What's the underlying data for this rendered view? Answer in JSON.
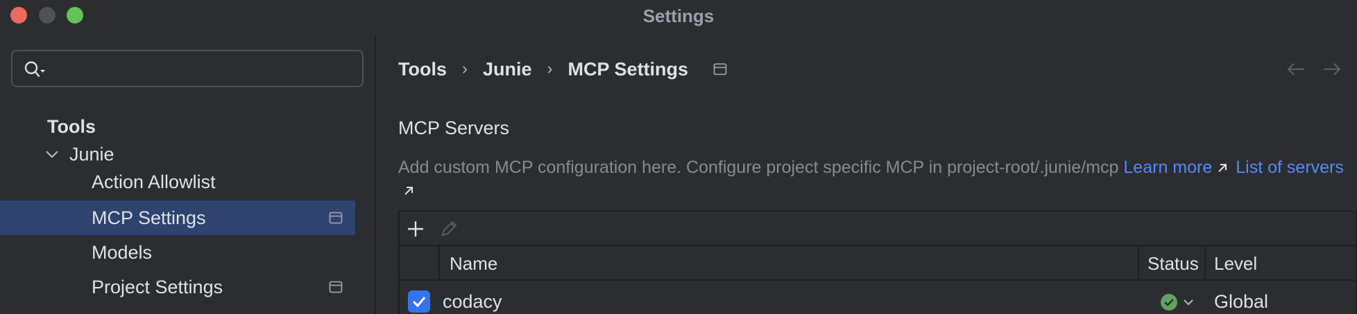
{
  "window": {
    "title": "Settings"
  },
  "search": {
    "placeholder": "",
    "value": ""
  },
  "sidebar": {
    "items": [
      {
        "label": "Tools"
      },
      {
        "label": "Junie"
      },
      {
        "label": "Action Allowlist"
      },
      {
        "label": "MCP Settings"
      },
      {
        "label": "Models"
      },
      {
        "label": "Project Settings"
      }
    ],
    "selected": "MCP Settings"
  },
  "breadcrumb": [
    "Tools",
    "Junie",
    "MCP Settings"
  ],
  "breadcrumb_sep": "›",
  "section": {
    "title": "MCP Servers",
    "description": "Add custom MCP configuration here. Configure project specific MCP in project-root/.junie/mcp",
    "learn_more": "Learn more",
    "list_of_servers": "List of servers"
  },
  "table": {
    "columns": [
      "Name",
      "Status",
      "Level"
    ],
    "rows": [
      {
        "enabled": true,
        "name": "codacy",
        "status": "ok",
        "level": "Global"
      }
    ]
  },
  "colors": {
    "background": "#2b2d30",
    "selection": "#2e436e",
    "accent": "#3574f0",
    "link": "#548af7",
    "status_ok": "#5fa35f"
  }
}
